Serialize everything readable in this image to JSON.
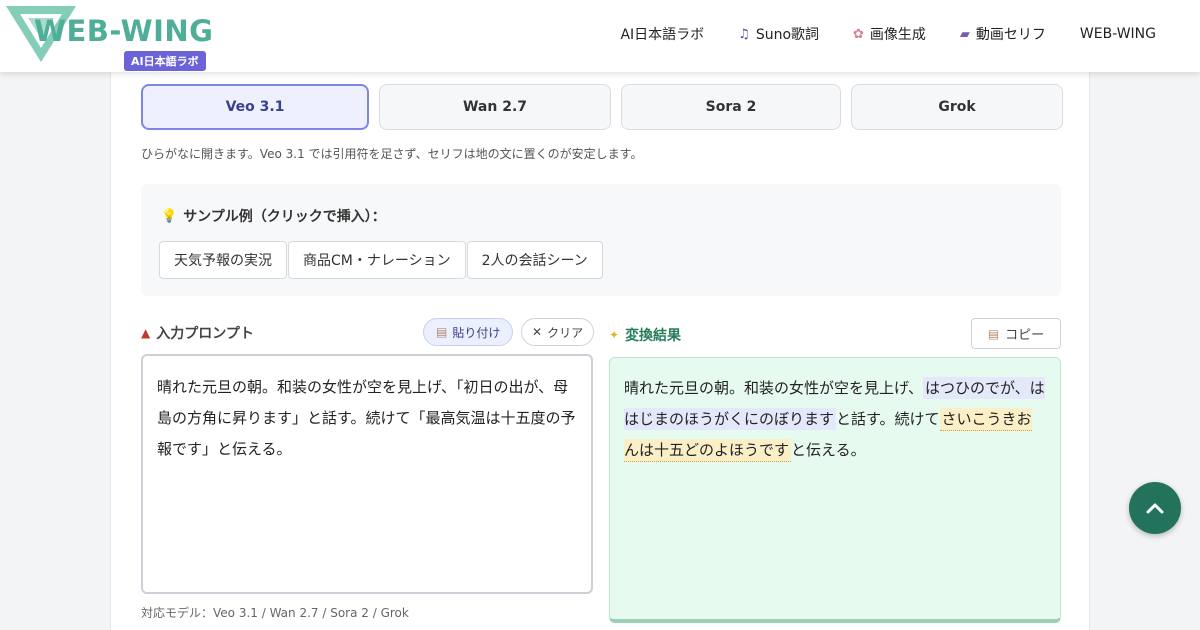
{
  "header": {
    "logo_text": "WEB-WING",
    "logo_badge": "AI日本語ラボ",
    "nav": [
      {
        "label": "AI日本語ラボ",
        "icon": ""
      },
      {
        "label": "Suno歌詞",
        "icon": "music-note-icon"
      },
      {
        "label": "画像生成",
        "icon": "brain-icon"
      },
      {
        "label": "動画セリフ",
        "icon": "clapperboard-icon"
      },
      {
        "label": "WEB-WING",
        "icon": ""
      }
    ]
  },
  "tabs": [
    "Veo 3.1",
    "Wan 2.7",
    "Sora 2",
    "Grok"
  ],
  "active_tab": "Veo 3.1",
  "tab_note": "ひらがなに開きます。Veo 3.1 では引用符を足さず、セリフは地の文に置くのが安定します。",
  "samples": {
    "title": "サンプル例（クリックで挿入）：",
    "items": [
      "天気予報の実況",
      "商品CM・ナレーション",
      "2人の会話シーン"
    ]
  },
  "input": {
    "label": "入力プロンプト",
    "paste_label": "貼り付け",
    "clear_label": "クリア",
    "text": "晴れた元旦の朝。和装の女性が空を見上げ、「初日の出が、母島の方角に昇ります」と話す。続けて「最高気温は十五度の予報です」と伝える。",
    "models_note": "対応モデル：Veo 3.1 / Wan 2.7 / Sora 2 / Grok"
  },
  "output": {
    "label": "変換結果",
    "copy_label": "コピー",
    "seg1": "晴れた元旦の朝。和装の女性が空を見上げ、",
    "seg2": "はつひのでが、ははじまのほうがくにのぼります",
    "seg3": "と話す。続けて",
    "seg4": "さいこうきおんは十五どのよほうです",
    "seg5": "と伝える。"
  },
  "colors": {
    "brand": "#4fae98",
    "accent": "#6c63d9",
    "active_tab_border": "#7f86e6",
    "output_bg": "#e6faef",
    "scroll_top_bg": "#23735c"
  }
}
